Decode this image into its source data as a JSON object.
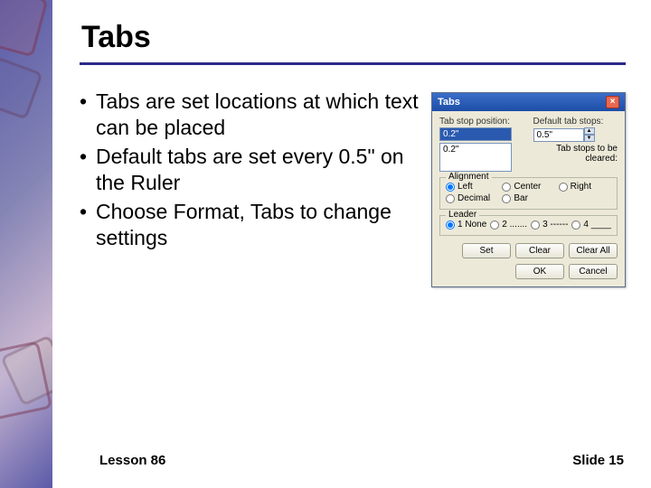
{
  "slide": {
    "title": "Tabs",
    "bullets": [
      "Tabs are set locations at which text can be placed",
      "Default tabs are set every 0.5\" on the Ruler",
      "Choose Format, Tabs to change settings"
    ],
    "footer_left": "Lesson 86",
    "footer_right": "Slide 15"
  },
  "dialog": {
    "title": "Tabs",
    "tab_stop_label": "Tab stop position:",
    "tab_stop_value": "0.2\"",
    "list_value": "0.2\"",
    "default_label": "Default tab stops:",
    "default_value": "0.5\"",
    "clear_label": "Tab stops to be cleared:",
    "alignment": {
      "legend": "Alignment",
      "options": [
        "Left",
        "Center",
        "Right",
        "Decimal",
        "Bar"
      ]
    },
    "leader": {
      "legend": "Leader",
      "options": [
        "1 None",
        "2 .......",
        "3 ------",
        "4 ____"
      ]
    },
    "buttons": {
      "set": "Set",
      "clear": "Clear",
      "clear_all": "Clear All",
      "ok": "OK",
      "cancel": "Cancel"
    }
  }
}
